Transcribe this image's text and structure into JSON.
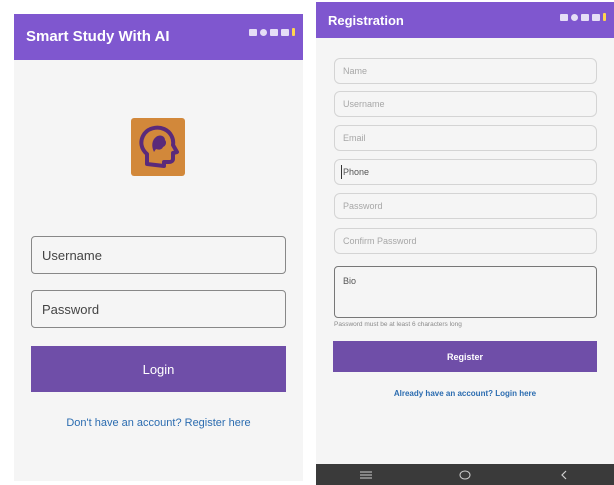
{
  "login": {
    "appbar_title": "Smart Study With AI",
    "username_placeholder": "Username",
    "password_placeholder": "Password",
    "login_label": "Login",
    "register_link": "Don't have an account? Register here"
  },
  "registration": {
    "appbar_title": "Registration",
    "fields": {
      "name": "Name",
      "username": "Username",
      "email": "Email",
      "phone": "Phone",
      "password": "Password",
      "confirm_password": "Confirm Password",
      "bio": "Bio"
    },
    "password_hint": "Password must be at least 6 characters long",
    "register_label": "Register",
    "login_link": "Already have an account? Login here"
  },
  "icons": {
    "logo": "brain-head-icon",
    "nav": [
      "menu-icon",
      "home-circle-icon",
      "back-chevron-icon"
    ]
  },
  "colors": {
    "appbar": "#7f57cf",
    "primary_button": "#6f4ea8",
    "logo_background": "#d2883a",
    "logo_glyph": "#5a2a7a",
    "link": "#2b6cb0",
    "navbar": "#3a3a3a"
  }
}
